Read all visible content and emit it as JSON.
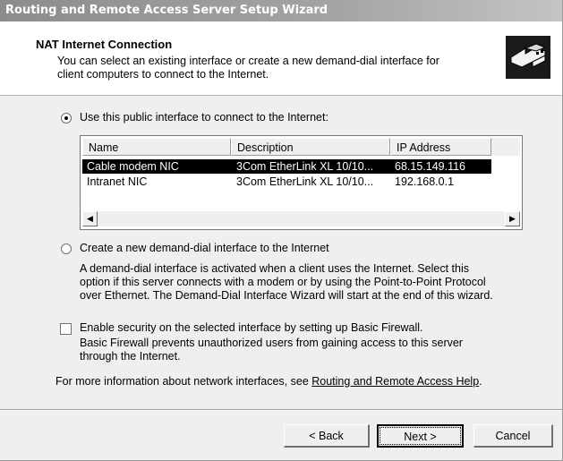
{
  "window": {
    "title": "Routing and Remote Access Server Setup Wizard"
  },
  "header": {
    "title": "NAT Internet Connection",
    "subtitle_line1": "You can select an existing interface or create a new demand-dial interface for",
    "subtitle_line2": "client computers to connect to the Internet.",
    "icon": "network-connection-icon"
  },
  "options": {
    "use_public_label": "Use this public interface to connect to the Internet:",
    "use_public_checked": true,
    "create_demand_label": "Create a new demand-dial interface to the Internet",
    "create_demand_checked": false,
    "demand_desc_line1": "A demand-dial interface is activated when a client uses the Internet. Select this",
    "demand_desc_line2": "option if this server connects with a modem or by using the Point-to-Point Protocol",
    "demand_desc_line3": "over Ethernet. The Demand-Dial Interface Wizard will start at the end of this wizard.",
    "firewall_label": "Enable security on the selected interface by setting up Basic Firewall.",
    "firewall_checked": false,
    "firewall_desc_line1": "Basic Firewall prevents unauthorized users from gaining access to this server",
    "firewall_desc_line2": "through the Internet."
  },
  "interfaces": {
    "columns": [
      "Name",
      "Description",
      "IP Address"
    ],
    "rows": [
      {
        "name": "Cable modem NIC",
        "description": "3Com EtherLink XL 10/10...",
        "ip": "68.15.149.116",
        "selected": true
      },
      {
        "name": "Intranet NIC",
        "description": "3Com EtherLink XL 10/10...",
        "ip": "192.168.0.1",
        "selected": false
      }
    ]
  },
  "footer": {
    "info_prefix": "For more information about network interfaces, see ",
    "info_link": "Routing and Remote Access Help",
    "info_suffix": "."
  },
  "buttons": {
    "back": "< Back",
    "next": "Next >",
    "cancel": "Cancel"
  }
}
